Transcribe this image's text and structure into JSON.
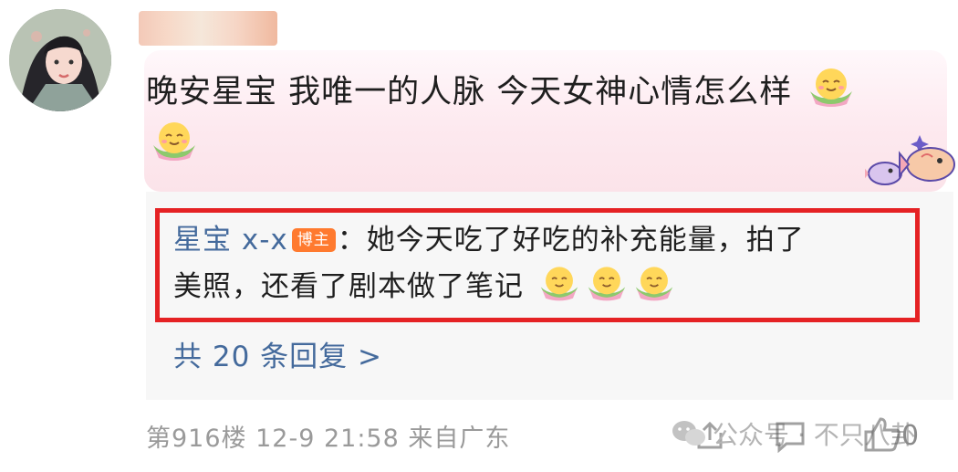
{
  "post": {
    "comment_text": "晚安星宝 我唯一的人脉 今天女神心情怎么样",
    "reply": {
      "author": "星宝 x-x",
      "badge": "博主",
      "separator": "：",
      "text_line1": "她今天吃了好吃的补充能量，拍了",
      "text_line2": "美照，还看了剧本做了笔记"
    },
    "more_replies": "共 20 条回复 >",
    "meta": "第916楼 12-9 21:58 来自广东",
    "like_count": "0"
  },
  "watermark": {
    "text": "公众号 · 不只八卦"
  },
  "icons": {
    "emoji": "smiling-face-flower-emoji",
    "sticker": "fish-sticker-icon",
    "like": "thumbs-up-icon",
    "comment": "comment-icon",
    "share": "share-icon",
    "wechat": "wechat-icon"
  },
  "colors": {
    "highlight_border": "#e52224",
    "reply_name": "#446a9c",
    "badge_bg": "#ff7a2f",
    "meta_text": "#9a9a9a"
  }
}
